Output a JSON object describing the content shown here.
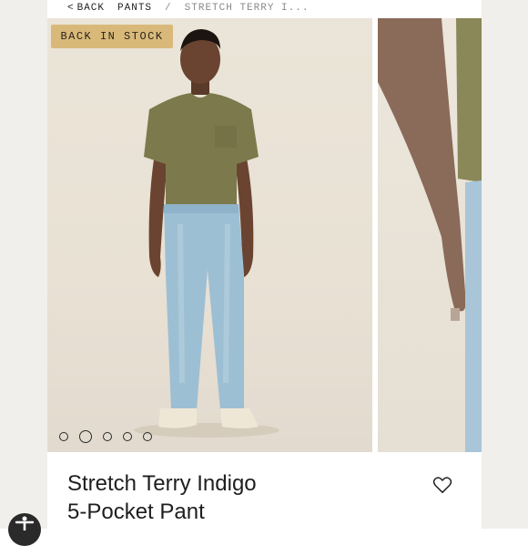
{
  "breadcrumb": {
    "back_label": "BACK",
    "category": "PANTS",
    "separator": "/",
    "current": "STRETCH TERRY I..."
  },
  "gallery": {
    "badge": "BACK IN STOCK",
    "dot_count": 5,
    "active_index": 1
  },
  "product": {
    "title_line1": "Stretch Terry Indigo",
    "title_line2": "5-Pocket Pant"
  },
  "icons": {
    "back": "chevron-left-icon",
    "favorite": "heart-icon",
    "accessibility": "accessibility-icon"
  },
  "colors": {
    "badge_bg": "#d9b97a",
    "photo_bg": "#e8e1d4",
    "text": "#1e1e1e"
  }
}
